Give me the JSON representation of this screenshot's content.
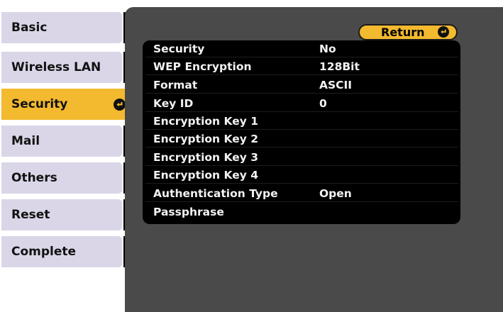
{
  "tabs": [
    {
      "label": "Basic"
    },
    {
      "label": "Wireless LAN"
    },
    {
      "label": "Security"
    },
    {
      "label": "Mail"
    },
    {
      "label": "Others"
    },
    {
      "label": "Reset"
    },
    {
      "label": "Complete"
    }
  ],
  "active_tab_index": 2,
  "return_button": {
    "label": "Return",
    "icon": "enter-icon"
  },
  "settings": [
    {
      "label": "Security",
      "value": "No"
    },
    {
      "label": "WEP Encryption",
      "value": "128Bit"
    },
    {
      "label": "Format",
      "value": "ASCII"
    },
    {
      "label": "Key ID",
      "value": " 0"
    },
    {
      "label": "Encryption Key 1",
      "value": ""
    },
    {
      "label": "Encryption Key 2",
      "value": ""
    },
    {
      "label": "Encryption Key 3",
      "value": ""
    },
    {
      "label": "Encryption Key 4",
      "value": ""
    },
    {
      "label": "Authentication Type",
      "value": "Open"
    },
    {
      "label": "Passphrase",
      "value": ""
    }
  ],
  "colors": {
    "tab": "#dad6e8",
    "active": "#f3b92f",
    "panel": "#4a4a4a",
    "settings_bg": "#000000",
    "text_light": "#f2f2f2"
  }
}
